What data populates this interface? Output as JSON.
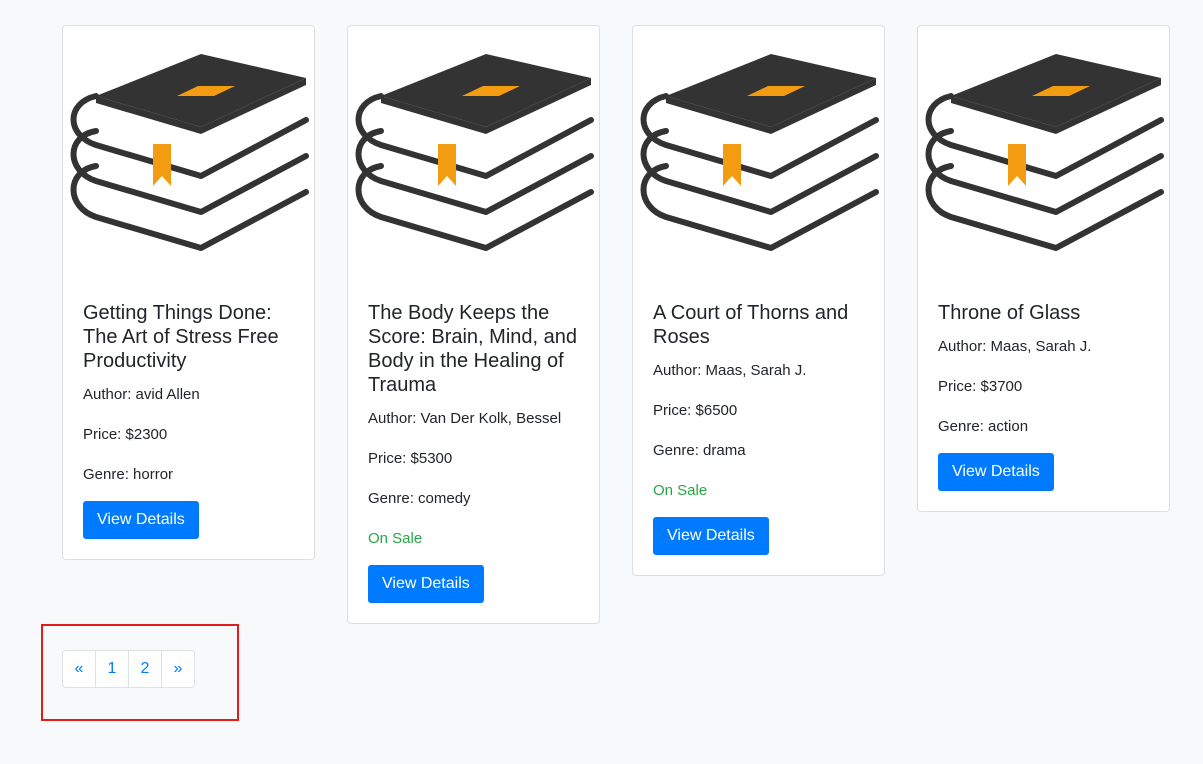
{
  "books": [
    {
      "title": "Getting Things Done: The Art of Stress Free Productivity",
      "author": "Author: avid Allen",
      "price": "Price: $2300",
      "genre": "Genre: horror",
      "sale": "",
      "button": "View Details",
      "icon": "book-stack-icon"
    },
    {
      "title": "The Body Keeps the Score: Brain, Mind, and Body in the Healing of Trauma",
      "author": "Author: Van Der Kolk, Bessel",
      "price": "Price: $5300",
      "genre": "Genre: comedy",
      "sale": "On Sale",
      "button": "View Details",
      "icon": "book-stack-icon"
    },
    {
      "title": "A Court of Thorns and Roses",
      "author": "Author: Maas, Sarah J.",
      "price": "Price: $6500",
      "genre": "Genre: drama",
      "sale": "On Sale",
      "button": "View Details",
      "icon": "book-stack-icon"
    },
    {
      "title": "Throne of Glass",
      "author": "Author: Maas, Sarah J.",
      "price": "Price: $3700",
      "genre": "Genre: action",
      "sale": "",
      "button": "View Details",
      "icon": "book-stack-icon"
    }
  ],
  "pagination": {
    "prev": "«",
    "pages": [
      "1",
      "2"
    ],
    "next": "»"
  },
  "colors": {
    "primary": "#007bff",
    "sale": "#28a745",
    "book_dark": "#333333",
    "book_accent": "#f39c12",
    "highlight": "#e31b1b"
  }
}
